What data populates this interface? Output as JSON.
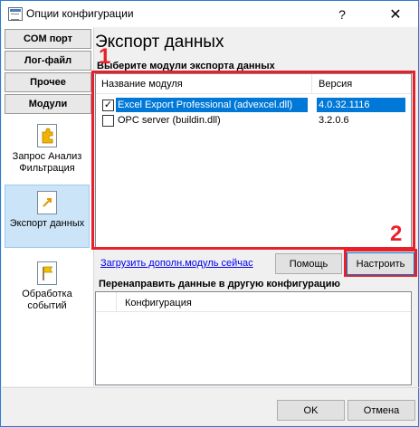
{
  "window": {
    "title": "Опции конфигурации",
    "help_symbol": "?",
    "close_symbol": "✕"
  },
  "sidebar": {
    "tabs": [
      {
        "label": "COM порт"
      },
      {
        "label": "Лог-файл"
      },
      {
        "label": "Прочее"
      },
      {
        "label": "Модули"
      }
    ],
    "items": [
      {
        "label": "Запрос Анализ Фильтрация",
        "icon": "puzzle-doc-icon"
      },
      {
        "label": "Экспорт данных",
        "icon": "export-doc-icon",
        "active": true
      },
      {
        "label": "Обработка событий",
        "icon": "flag-doc-icon"
      }
    ]
  },
  "main": {
    "title": "Экспорт данных",
    "group_label": "Выберите модули экспорта данных",
    "columns": [
      "Название модуля",
      "Версия"
    ],
    "rows": [
      {
        "checked": true,
        "name": "Excel Export Professional (advexcel.dll)",
        "version": "4.0.32.1116",
        "selected": true
      },
      {
        "checked": false,
        "name": "OPC server (buildin.dll)",
        "version": "3.2.0.6",
        "selected": false
      }
    ],
    "load_link": "Загрузить дополн.модуль сейчас",
    "help_button": "Помощь",
    "configure_button": "Настроить",
    "redirect_label": "Перенаправить данные в другую конфигурацию",
    "redirect_column": "Конфигурация"
  },
  "annotations": {
    "callout_1": "1",
    "callout_2": "2",
    "color": "#e8202a"
  },
  "footer": {
    "ok_button": "OK",
    "cancel_button": "Отмена"
  },
  "colors": {
    "selection": "#0078d7",
    "active_item": "#cce4f7",
    "link": "#0000ee"
  }
}
